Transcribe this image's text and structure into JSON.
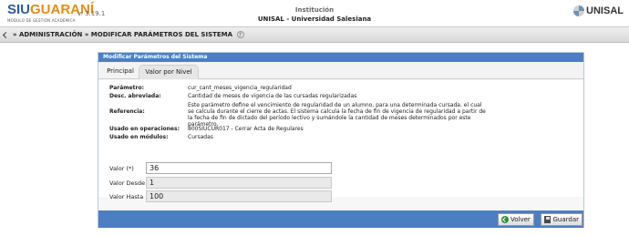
{
  "header": {
    "logo_siu": "SIU",
    "logo_guarani": "GUARANÍ",
    "logo_subtitle": "MÓDULO DE GESTIÓN ACADÉMICA",
    "version": "v. 3.19.1",
    "institution_label": "Institución",
    "institution_name": "UNISAL - Universidad Salesiana",
    "brand_right": "UNISAL"
  },
  "breadcrumb": {
    "text": "» ADMINISTRACIÓN » MODIFICAR PARÁMETROS DEL SISTEMA",
    "help": "?"
  },
  "panel": {
    "title": "Modificar Parámetros del Sistema",
    "tabs": [
      {
        "label": "Principal"
      },
      {
        "label": "Valor por Nivel"
      }
    ],
    "details": [
      {
        "label": "Parámetro:",
        "value": "cur_cant_meses_vigencia_regularidad"
      },
      {
        "label": "Desc. abreviada:",
        "value": "Cantidad de meses de vigencia de las cursadas regularizadas"
      },
      {
        "label": "Referencia:",
        "value": "Este parámetro define el vencimiento de regularidad de un alumno, para una determinada cursada. el cual se calcula durante el cierre de actas. El sistema calcula la fecha de fin de vigencia de regularidad a partir de la fecha de fin de dictado del período lectivo y sumándole la cantidad de meses determinados por este parámetro."
      },
      {
        "label": "Usado en operaciones:",
        "value": "800SIUCUR017 - Cerrar Acta de Regulares"
      },
      {
        "label": "Usado en módulos:",
        "value": "Cursadas"
      }
    ],
    "fields": {
      "valor_label": "Valor (*)",
      "valor": "36",
      "desde_label": "Valor Desde",
      "desde": "1",
      "hasta_label": "Valor Hasta",
      "hasta": "100"
    },
    "buttons": {
      "volver": "Volver",
      "guardar": "Guardar"
    }
  },
  "colors": {
    "panel_header": "#4c7fc2",
    "logo_blue": "#2c5b99",
    "logo_orange": "#e48b1a"
  }
}
